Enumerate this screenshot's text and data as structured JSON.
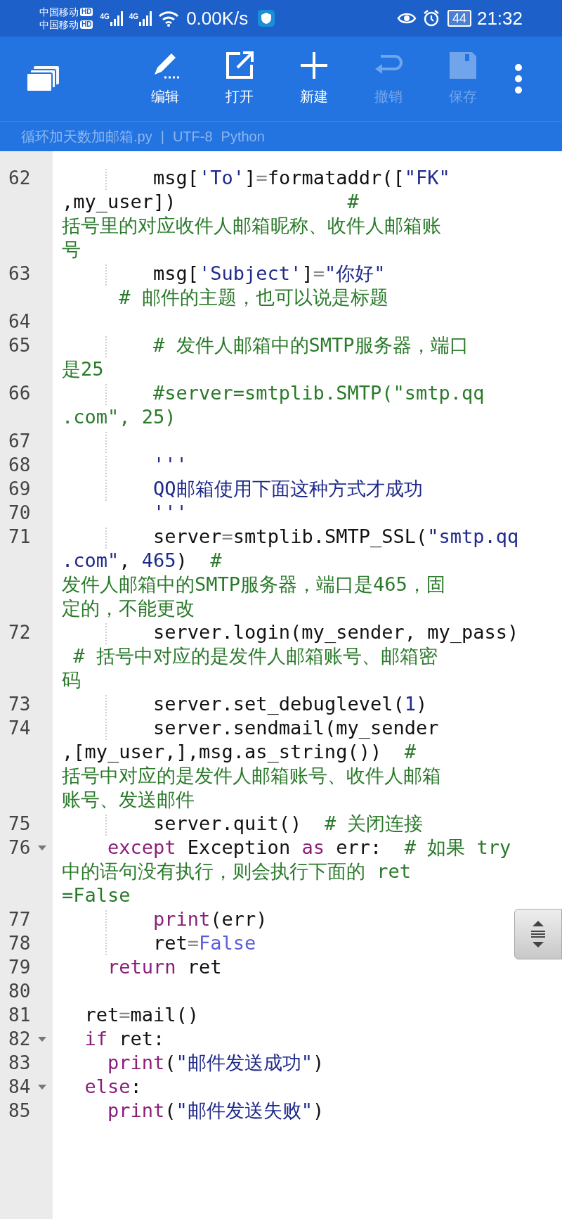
{
  "status_bar": {
    "carriers": [
      {
        "name": "中国移动",
        "badge": "HD"
      },
      {
        "name": "中国移动",
        "badge": "HD"
      }
    ],
    "network_types": [
      "4G",
      "4G"
    ],
    "speed": "0.00K/s",
    "battery": "44",
    "time": "21:32"
  },
  "toolbar": {
    "buttons": [
      {
        "kind": "edit",
        "label": "编辑",
        "disabled": false
      },
      {
        "kind": "open",
        "label": "打开",
        "disabled": false
      },
      {
        "kind": "new",
        "label": "新建",
        "disabled": false
      },
      {
        "kind": "undo",
        "label": "撤销",
        "disabled": true
      },
      {
        "kind": "save",
        "label": "保存",
        "disabled": true
      }
    ]
  },
  "file_bar": {
    "filename": "循环加天数加邮箱.py",
    "separator": "|",
    "encoding": "UTF-8",
    "language": "Python"
  },
  "editor": {
    "lines": [
      {
        "number": "62",
        "foldable": false,
        "guide": true,
        "rows": [
          {
            "tokens": [
              {
                "kind": "plain",
                "text": "        msg["
              },
              {
                "kind": "string",
                "text": "'To'"
              },
              {
                "kind": "plain",
                "text": "]"
              },
              {
                "kind": "op",
                "text": "="
              },
              {
                "kind": "plain",
                "text": "formataddr(["
              },
              {
                "kind": "string",
                "text": "\"FK\""
              }
            ]
          },
          {
            "tokens": [
              {
                "kind": "plain",
                "text": ",my_user])"
              },
              {
                "kind": "comment",
                "text": "               #"
              }
            ]
          },
          {
            "tokens": [
              {
                "kind": "comment",
                "text": "括号里的对应收件人邮箱昵称、收件人邮箱账"
              }
            ]
          },
          {
            "tokens": [
              {
                "kind": "comment",
                "text": "号"
              }
            ]
          }
        ]
      },
      {
        "number": "63",
        "foldable": false,
        "guide": true,
        "rows": [
          {
            "tokens": [
              {
                "kind": "plain",
                "text": "        msg["
              },
              {
                "kind": "string",
                "text": "'Subject'"
              },
              {
                "kind": "plain",
                "text": "]"
              },
              {
                "kind": "op",
                "text": "="
              },
              {
                "kind": "string",
                "text": "\"你好\""
              }
            ]
          },
          {
            "tokens": [
              {
                "kind": "comment",
                "text": "     # 邮件的主题，也可以说是标题"
              }
            ]
          }
        ]
      },
      {
        "number": "64",
        "foldable": false,
        "guide": false,
        "rows": [
          {
            "tokens": []
          }
        ]
      },
      {
        "number": "65",
        "foldable": false,
        "guide": true,
        "rows": [
          {
            "tokens": [
              {
                "kind": "comment",
                "text": "        # 发件人邮箱中的SMTP服务器，端口"
              }
            ]
          },
          {
            "tokens": [
              {
                "kind": "comment",
                "text": "是25"
              }
            ]
          }
        ]
      },
      {
        "number": "66",
        "foldable": false,
        "guide": true,
        "rows": [
          {
            "tokens": [
              {
                "kind": "comment",
                "text": "        #server=smtplib.SMTP(\"smtp.qq"
              }
            ]
          },
          {
            "tokens": [
              {
                "kind": "comment",
                "text": ".com\", 25)"
              }
            ]
          }
        ]
      },
      {
        "number": "67",
        "foldable": false,
        "guide": true,
        "rows": [
          {
            "tokens": []
          }
        ]
      },
      {
        "number": "68",
        "foldable": false,
        "guide": true,
        "rows": [
          {
            "tokens": [
              {
                "kind": "string",
                "text": "        '''"
              }
            ]
          }
        ]
      },
      {
        "number": "69",
        "foldable": false,
        "guide": true,
        "rows": [
          {
            "tokens": [
              {
                "kind": "string",
                "text": "        QQ邮箱使用下面这种方式才成功"
              }
            ]
          }
        ]
      },
      {
        "number": "70",
        "foldable": false,
        "guide": false,
        "rows": [
          {
            "tokens": [
              {
                "kind": "string",
                "text": "        '''"
              }
            ]
          }
        ]
      },
      {
        "number": "71",
        "foldable": false,
        "guide": true,
        "rows": [
          {
            "tokens": [
              {
                "kind": "plain",
                "text": "        server"
              },
              {
                "kind": "op",
                "text": "="
              },
              {
                "kind": "plain",
                "text": "smtplib.SMTP_SSL("
              },
              {
                "kind": "string",
                "text": "\"smtp.qq"
              }
            ]
          },
          {
            "tokens": [
              {
                "kind": "string",
                "text": ".com\""
              },
              {
                "kind": "plain",
                "text": ", "
              },
              {
                "kind": "number",
                "text": "465"
              },
              {
                "kind": "plain",
                "text": ")  "
              },
              {
                "kind": "comment",
                "text": "#"
              }
            ]
          },
          {
            "tokens": [
              {
                "kind": "comment",
                "text": "发件人邮箱中的SMTP服务器，端口是465，固"
              }
            ]
          },
          {
            "tokens": [
              {
                "kind": "comment",
                "text": "定的，不能更改"
              }
            ]
          }
        ]
      },
      {
        "number": "72",
        "foldable": false,
        "guide": true,
        "rows": [
          {
            "tokens": [
              {
                "kind": "plain",
                "text": "        server.login(my_sender, my_pass)"
              }
            ]
          },
          {
            "tokens": [
              {
                "kind": "comment",
                "text": " # 括号中对应的是发件人邮箱账号、邮箱密"
              }
            ]
          },
          {
            "tokens": [
              {
                "kind": "comment",
                "text": "码"
              }
            ]
          }
        ]
      },
      {
        "number": "73",
        "foldable": false,
        "guide": true,
        "rows": [
          {
            "tokens": [
              {
                "kind": "plain",
                "text": "        server.set_debuglevel("
              },
              {
                "kind": "number",
                "text": "1"
              },
              {
                "kind": "plain",
                "text": ")"
              }
            ]
          }
        ]
      },
      {
        "number": "74",
        "foldable": false,
        "guide": true,
        "rows": [
          {
            "tokens": [
              {
                "kind": "plain",
                "text": "        server.sendmail(my_sender"
              }
            ]
          },
          {
            "tokens": [
              {
                "kind": "plain",
                "text": ",[my_user,],msg.as_string())  "
              },
              {
                "kind": "comment",
                "text": "#"
              }
            ]
          },
          {
            "tokens": [
              {
                "kind": "comment",
                "text": "括号中对应的是发件人邮箱账号、收件人邮箱"
              }
            ]
          },
          {
            "tokens": [
              {
                "kind": "comment",
                "text": "账号、发送邮件"
              }
            ]
          }
        ]
      },
      {
        "number": "75",
        "foldable": false,
        "guide": true,
        "rows": [
          {
            "tokens": [
              {
                "kind": "plain",
                "text": "        server.quit()  "
              },
              {
                "kind": "comment",
                "text": "# 关闭连接"
              }
            ]
          }
        ]
      },
      {
        "number": "76",
        "foldable": true,
        "guide": false,
        "rows": [
          {
            "tokens": [
              {
                "kind": "keyword",
                "text": "    except"
              },
              {
                "kind": "plain",
                "text": " Exception "
              },
              {
                "kind": "keyword",
                "text": "as"
              },
              {
                "kind": "plain",
                "text": " err:  "
              },
              {
                "kind": "comment",
                "text": "# 如果 try"
              }
            ]
          },
          {
            "tokens": [
              {
                "kind": "comment",
                "text": "中的语句没有执行，则会执行下面的 ret"
              }
            ]
          },
          {
            "tokens": [
              {
                "kind": "comment",
                "text": "=False"
              }
            ]
          }
        ]
      },
      {
        "number": "77",
        "foldable": false,
        "guide": true,
        "rows": [
          {
            "tokens": [
              {
                "kind": "keyword",
                "text": "        print"
              },
              {
                "kind": "plain",
                "text": "(err)"
              }
            ]
          }
        ]
      },
      {
        "number": "78",
        "foldable": false,
        "guide": true,
        "rows": [
          {
            "tokens": [
              {
                "kind": "plain",
                "text": "        ret"
              },
              {
                "kind": "op",
                "text": "="
              },
              {
                "kind": "constant",
                "text": "False"
              }
            ]
          }
        ]
      },
      {
        "number": "79",
        "foldable": false,
        "guide": false,
        "rows": [
          {
            "tokens": [
              {
                "kind": "keyword",
                "text": "    return"
              },
              {
                "kind": "plain",
                "text": " ret"
              }
            ]
          }
        ]
      },
      {
        "number": "80",
        "foldable": false,
        "guide": false,
        "rows": [
          {
            "tokens": []
          }
        ]
      },
      {
        "number": "81",
        "foldable": false,
        "guide": false,
        "rows": [
          {
            "tokens": [
              {
                "kind": "plain",
                "text": "  ret"
              },
              {
                "kind": "op",
                "text": "="
              },
              {
                "kind": "plain",
                "text": "mail()"
              }
            ]
          }
        ]
      },
      {
        "number": "82",
        "foldable": true,
        "guide": false,
        "rows": [
          {
            "tokens": [
              {
                "kind": "keyword",
                "text": "  if"
              },
              {
                "kind": "plain",
                "text": " ret:"
              }
            ]
          }
        ]
      },
      {
        "number": "83",
        "foldable": false,
        "guide": false,
        "rows": [
          {
            "tokens": [
              {
                "kind": "keyword",
                "text": "    print"
              },
              {
                "kind": "plain",
                "text": "("
              },
              {
                "kind": "string",
                "text": "\"邮件发送成功\""
              },
              {
                "kind": "plain",
                "text": ")"
              }
            ]
          }
        ]
      },
      {
        "number": "84",
        "foldable": true,
        "guide": false,
        "rows": [
          {
            "tokens": [
              {
                "kind": "keyword",
                "text": "  else"
              },
              {
                "kind": "plain",
                "text": ":"
              }
            ]
          }
        ]
      },
      {
        "number": "85",
        "foldable": false,
        "guide": false,
        "rows": [
          {
            "tokens": [
              {
                "kind": "keyword",
                "text": "    print"
              },
              {
                "kind": "plain",
                "text": "("
              },
              {
                "kind": "string",
                "text": "\"邮件发送失败\""
              },
              {
                "kind": "plain",
                "text": ")"
              }
            ]
          }
        ]
      }
    ]
  }
}
